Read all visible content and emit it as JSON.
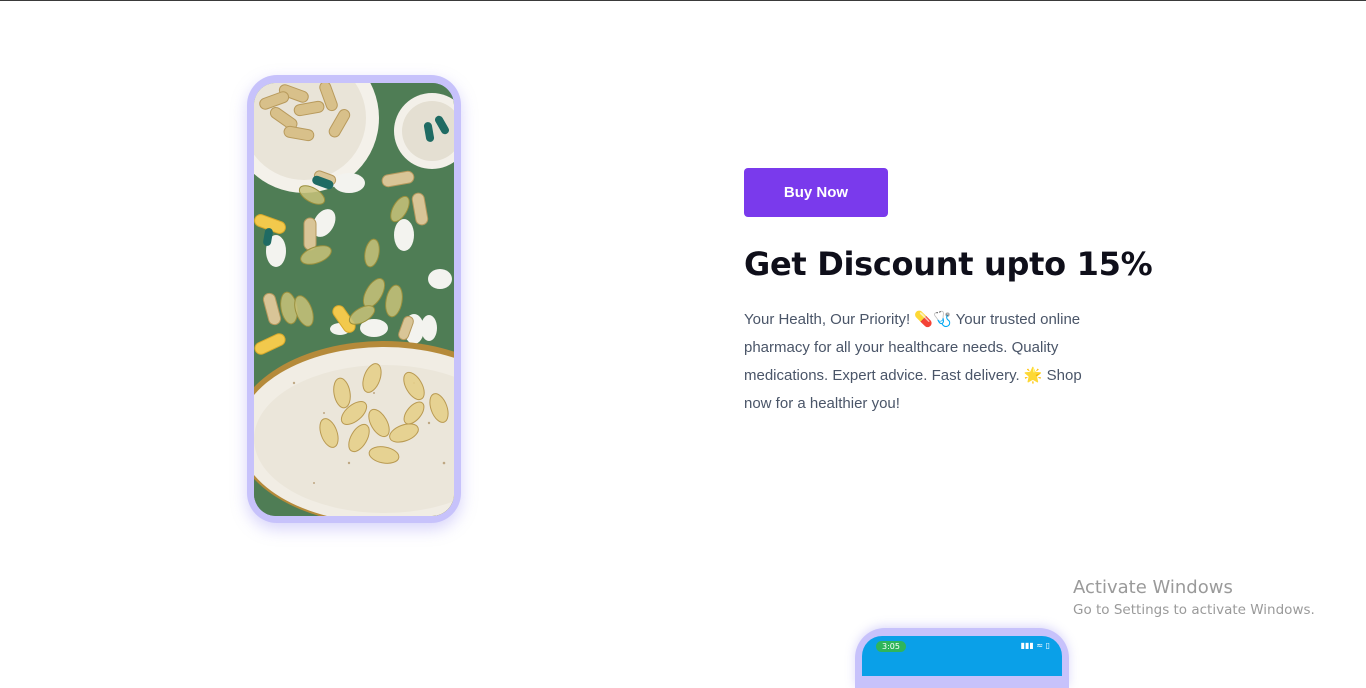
{
  "promo": {
    "button_label": "Buy Now",
    "headline": "Get Discount upto 15%",
    "description": "Your Health, Our Priority! 💊🩺 Your trusted online pharmacy for all your healthcare needs. Quality medications. Expert advice. Fast delivery. 🌟 Shop now for a healthier you!"
  },
  "second_phone": {
    "status_time": "3:05",
    "status_icons": "▮▮▮ ≈ ▯"
  },
  "watermark": {
    "title": "Activate Windows",
    "subtitle": "Go to Settings to activate Windows."
  },
  "colors": {
    "accent": "#7a3aec",
    "phone_frame": "#c7c2fb",
    "pills_background": "#4f7d55"
  },
  "icons": [
    "pill-icon",
    "stethoscope-icon",
    "sparkle-icon"
  ]
}
